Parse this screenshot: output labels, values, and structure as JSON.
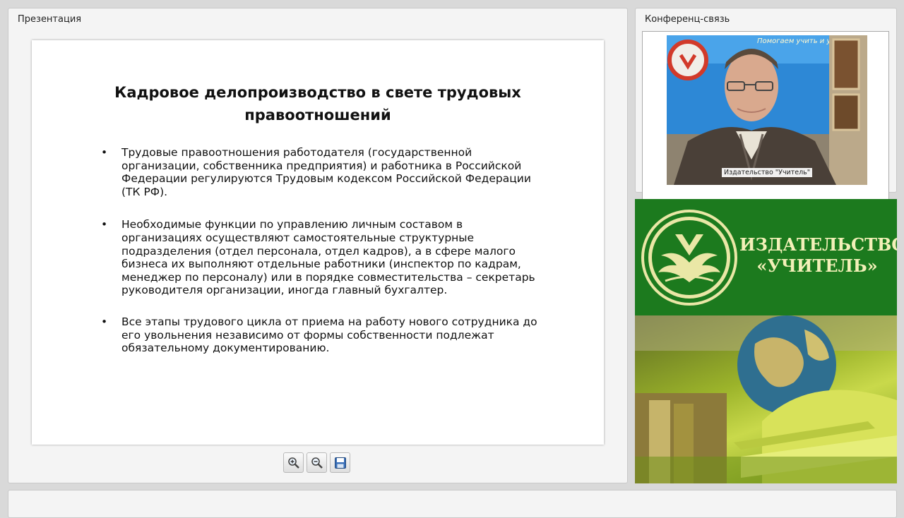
{
  "presentation": {
    "panel_title": "Презентация",
    "slide": {
      "title_line1": "Кадровое делопроизводство в свете трудовых",
      "title_line2": "правоотношений",
      "bullets": [
        {
          "lines": [
            "Трудовые правоотношения работодателя (государственной",
            "организации, собственника предприятия) и работника в Российской",
            "Федерации регулируются Трудовым кодексом Российской Федерации",
            "(ТК РФ)."
          ]
        },
        {
          "lines": [
            "Необходимые функции по управлению личным составом в",
            "организациях осуществляют самостоятельные структурные",
            "подразделения (отдел персонала, отдел кадров), а в сфере малого",
            "бизнеса их выполняют отдельные работники (инспектор по кадрам,",
            "менеджер по персоналу) или в порядке совместительства – секретарь",
            "руководителя организации, иногда главный бухгалтер."
          ]
        },
        {
          "lines": [
            "Все этапы трудового цикла от приема на работу нового сотрудника до",
            "его увольнения независимо от формы собственности подлежат",
            "обязательному документированию."
          ]
        }
      ]
    },
    "toolbar": {
      "zoom_in_icon": "zoom-in-icon",
      "zoom_out_icon": "zoom-out-icon",
      "save_icon": "floppy-disk-icon"
    }
  },
  "conference": {
    "panel_title": "Конференц-связь",
    "video_caption": "Издательство \"Учитель\"",
    "background_poster_text": "Помогаем учить и учиться · Учитель"
  },
  "banner": {
    "publisher_line1": "ИЗДАТЕЛЬСТВО",
    "publisher_line2": "«УЧИТЕЛЬ»",
    "colors": {
      "green": "#1c7a1e",
      "cream": "#f3f0b8"
    }
  }
}
